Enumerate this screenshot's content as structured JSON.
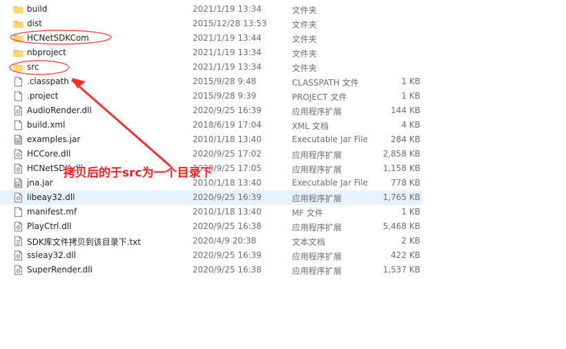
{
  "files": [
    {
      "name": "build",
      "date": "2021/1/19 13:34",
      "type": "文件夹",
      "size": "",
      "icon": "folder-icon"
    },
    {
      "name": "dist",
      "date": "2015/12/28 13:53",
      "type": "文件夹",
      "size": "",
      "icon": "folder-icon"
    },
    {
      "name": "HCNetSDKCom",
      "date": "2021/1/19 13:44",
      "type": "文件夹",
      "size": "",
      "icon": "folder-icon"
    },
    {
      "name": "nbproject",
      "date": "2021/1/19 13:34",
      "type": "文件夹",
      "size": "",
      "icon": "folder-icon"
    },
    {
      "name": "src",
      "date": "2021/1/19 13:34",
      "type": "文件夹",
      "size": "",
      "icon": "folder-icon"
    },
    {
      "name": ".classpath",
      "date": "2015/9/28 9:48",
      "type": "CLASSPATH 文件",
      "size": "1 KB",
      "icon": "file-icon"
    },
    {
      "name": ".project",
      "date": "2015/9/28 9:39",
      "type": "PROJECT 文件",
      "size": "1 KB",
      "icon": "file-icon"
    },
    {
      "name": "AudioRender.dll",
      "date": "2020/9/25 16:39",
      "type": "应用程序扩展",
      "size": "144 KB",
      "icon": "dll-icon"
    },
    {
      "name": "build.xml",
      "date": "2018/6/19 17:04",
      "type": "XML 文档",
      "size": "4 KB",
      "icon": "file-icon"
    },
    {
      "name": "examples.jar",
      "date": "2010/1/18 13:40",
      "type": "Executable Jar File",
      "size": "284 KB",
      "icon": "jar-icon"
    },
    {
      "name": "HCCore.dll",
      "date": "2020/9/25 17:02",
      "type": "应用程序扩展",
      "size": "2,858 KB",
      "icon": "dll-icon"
    },
    {
      "name": "HCNetSDK.dll",
      "date": "2020/9/25 17:05",
      "type": "应用程序扩展",
      "size": "1,158 KB",
      "icon": "dll-icon"
    },
    {
      "name": "jna.jar",
      "date": "2010/1/18 13:40",
      "type": "Executable Jar File",
      "size": "778 KB",
      "icon": "jar-icon"
    },
    {
      "name": "libeay32.dll",
      "date": "2020/9/25 16:39",
      "type": "应用程序扩展",
      "size": "1,765 KB",
      "icon": "dll-icon",
      "selected": true
    },
    {
      "name": "manifest.mf",
      "date": "2010/1/18 13:40",
      "type": "MF 文件",
      "size": "1 KB",
      "icon": "file-icon"
    },
    {
      "name": "PlayCtrl.dll",
      "date": "2020/9/25 16:38",
      "type": "应用程序扩展",
      "size": "5,468 KB",
      "icon": "dll-icon"
    },
    {
      "name": "SDK库文件拷贝到该目录下.txt",
      "date": "2020/4/9 20:38",
      "type": "文本文档",
      "size": "2 KB",
      "icon": "text-file-icon"
    },
    {
      "name": "ssleay32.dll",
      "date": "2020/9/25 16:39",
      "type": "应用程序扩展",
      "size": "422 KB",
      "icon": "dll-icon"
    },
    {
      "name": "SuperRender.dll",
      "date": "2020/9/25 16:38",
      "type": "应用程序扩展",
      "size": "1,537 KB",
      "icon": "dll-icon"
    }
  ],
  "annotation": {
    "text": "拷贝后的于src为一个目录下",
    "color": "#ff1a1a"
  }
}
